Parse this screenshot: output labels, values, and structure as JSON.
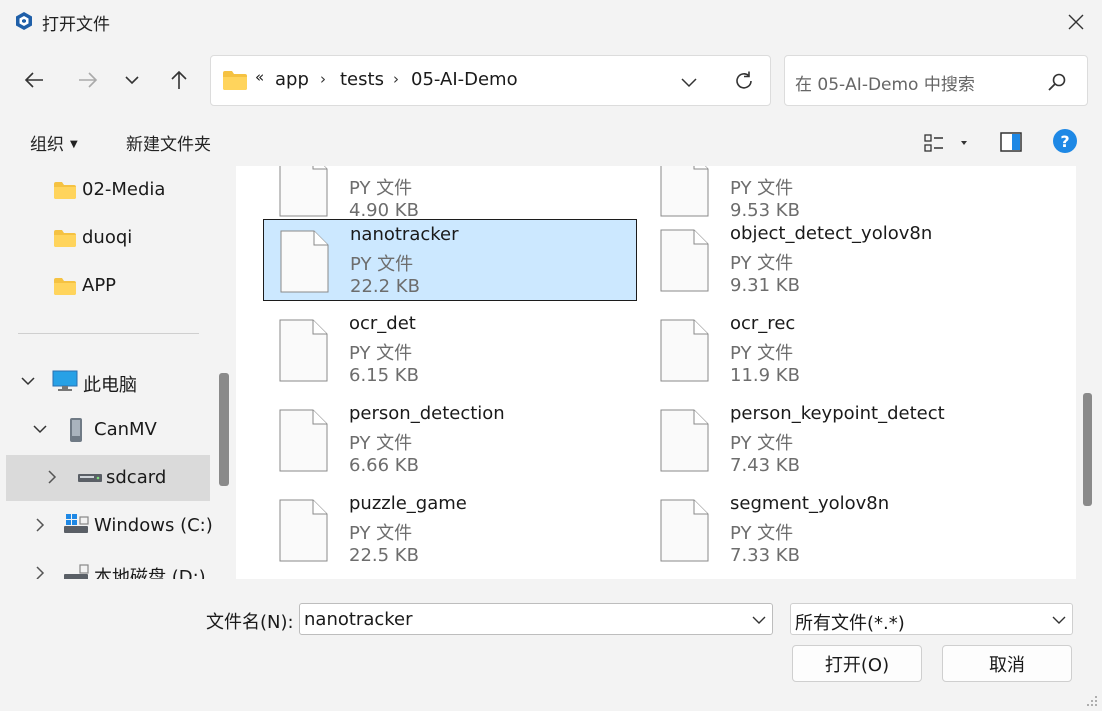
{
  "window": {
    "title": "打开文件"
  },
  "address": {
    "overflow": "«",
    "crumbs": [
      "app",
      "tests",
      "05-AI-Demo"
    ]
  },
  "search": {
    "placeholder": "在 05-AI-Demo 中搜索"
  },
  "toolbar": {
    "organize": "组织",
    "new_folder": "新建文件夹",
    "help": "?"
  },
  "sidebar": {
    "folders": [
      "02-Media",
      "duoqi",
      "APP"
    ],
    "this_pc": "此电脑",
    "canmv": "CanMV",
    "sdcard": "sdcard",
    "windows_c": "Windows (C:)",
    "local_d": "本地磁盘 (D:)"
  },
  "files": [
    {
      "name": "",
      "type": "PY 文件",
      "size": "4.90 KB"
    },
    {
      "name": "",
      "type": "PY 文件",
      "size": "9.53 KB"
    },
    {
      "name": "nanotracker",
      "type": "PY 文件",
      "size": "22.2 KB",
      "selected": true
    },
    {
      "name": "object_detect_yolov8n",
      "type": "PY 文件",
      "size": "9.31 KB"
    },
    {
      "name": "ocr_det",
      "type": "PY 文件",
      "size": "6.15 KB"
    },
    {
      "name": "ocr_rec",
      "type": "PY 文件",
      "size": "11.9 KB"
    },
    {
      "name": "person_detection",
      "type": "PY 文件",
      "size": "6.66 KB"
    },
    {
      "name": "person_keypoint_detect",
      "type": "PY 文件",
      "size": "7.43 KB"
    },
    {
      "name": "puzzle_game",
      "type": "PY 文件",
      "size": "22.5 KB"
    },
    {
      "name": "segment_yolov8n",
      "type": "PY 文件",
      "size": "7.33 KB"
    }
  ],
  "bottom": {
    "filename_label": "文件名(N):",
    "filename_value": "nanotracker",
    "filetype_value": "所有文件(*.*)",
    "open": "打开(O)",
    "cancel": "取消"
  },
  "colors": {
    "accent": "#0067c0",
    "selection": "#cce8ff",
    "folder": "#f5c242",
    "help": "#1e88e5"
  }
}
